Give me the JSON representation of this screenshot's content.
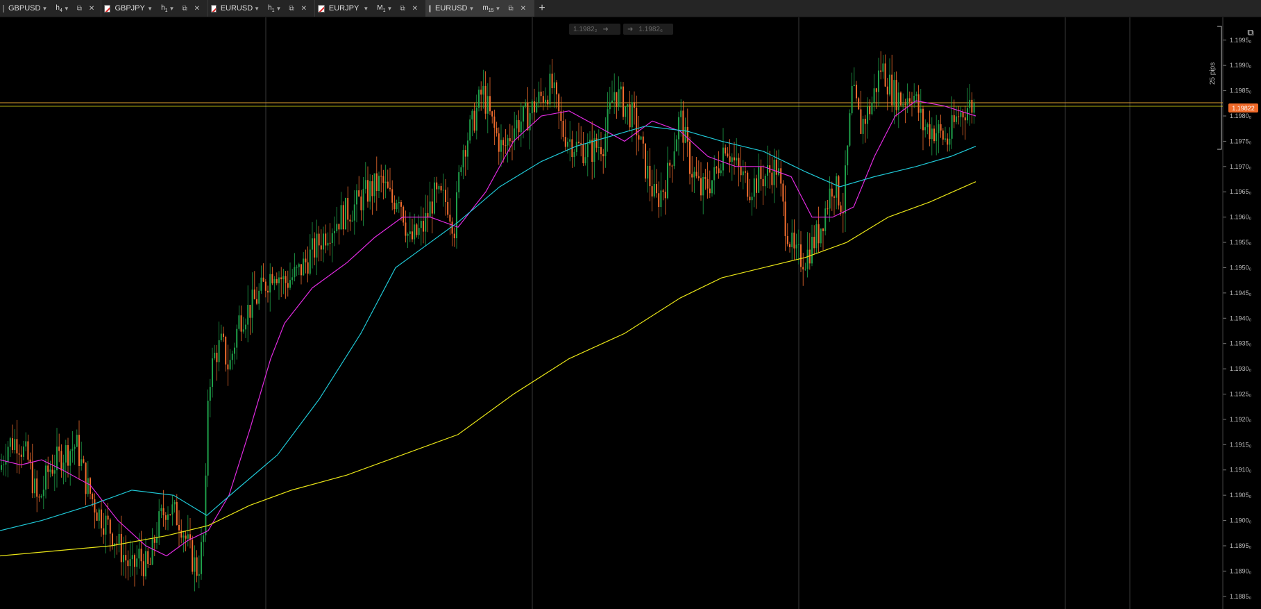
{
  "tabs": [
    {
      "symbol": "GBPUSD",
      "timeframe": "h",
      "tf_sub": "4",
      "active": false
    },
    {
      "symbol": "GBPJPY",
      "timeframe": "h",
      "tf_sub": "1",
      "active": false
    },
    {
      "symbol": "EURUSD",
      "timeframe": "h",
      "tf_sub": "1",
      "active": false
    },
    {
      "symbol": "EURJPY",
      "timeframe": "M",
      "tf_sub": "1",
      "active": false
    },
    {
      "symbol": "EURUSD",
      "timeframe": "m",
      "tf_sub": "15",
      "active": true
    }
  ],
  "add_tab_icon": "plus-icon",
  "trade_panel": {
    "sell_price": "1.1982₂",
    "buy_price": "1.1982₆"
  },
  "current_price": "1.19822",
  "range_label": "25 pips",
  "colors": {
    "bull": "#1fa04a",
    "bear": "#f26d2e",
    "ma_fast": "#e02ae0",
    "ma_mid": "#1fc8d6",
    "ma_slow": "#e8e417",
    "price_line": "#e0a030",
    "background": "#000000"
  },
  "price_axis": {
    "labels": [
      "1.1995₀",
      "1.1990₀",
      "1.1985₀",
      "1.1980₀",
      "1.1975₀",
      "1.1970₀",
      "1.1965₀",
      "1.1960₀",
      "1.1955₀",
      "1.1950₀",
      "1.1945₀",
      "1.1940₀",
      "1.1935₀",
      "1.1930₀",
      "1.1925₀",
      "1.1920₀",
      "1.1915₀",
      "1.1910₀",
      "1.1905₀",
      "1.1900₀",
      "1.1895₀",
      "1.1890₀",
      "1.1885₀"
    ],
    "values": [
      1.1995,
      1.199,
      1.1985,
      1.198,
      1.1975,
      1.197,
      1.1965,
      1.196,
      1.1955,
      1.195,
      1.1945,
      1.194,
      1.1935,
      1.193,
      1.1925,
      1.192,
      1.1915,
      1.191,
      1.1905,
      1.19,
      1.1895,
      1.189,
      1.1885
    ],
    "min": 1.18825,
    "max": 1.19995
  },
  "chart_data": {
    "type": "candlestick",
    "symbol": "EURUSD",
    "timeframe": "m15",
    "price_range": [
      1.18825,
      1.19995
    ],
    "current_price": 1.19822,
    "moving_averages": [
      {
        "color": "#e02ae0",
        "points": [
          [
            0,
            1.1912
          ],
          [
            30,
            1.1911
          ],
          [
            60,
            1.1912
          ],
          [
            90,
            1.191
          ],
          [
            130,
            1.1907
          ],
          [
            170,
            1.19
          ],
          [
            210,
            1.1895
          ],
          [
            240,
            1.1893
          ],
          [
            270,
            1.1896
          ],
          [
            300,
            1.1898
          ],
          [
            330,
            1.1905
          ],
          [
            360,
            1.1918
          ],
          [
            390,
            1.1932
          ],
          [
            410,
            1.1939
          ],
          [
            450,
            1.1946
          ],
          [
            500,
            1.1951
          ],
          [
            540,
            1.1956
          ],
          [
            580,
            1.196
          ],
          [
            620,
            1.196
          ],
          [
            660,
            1.1958
          ],
          [
            700,
            1.1965
          ],
          [
            740,
            1.1975
          ],
          [
            780,
            1.198
          ],
          [
            820,
            1.1981
          ],
          [
            860,
            1.1978
          ],
          [
            900,
            1.1975
          ],
          [
            940,
            1.1979
          ],
          [
            980,
            1.1977
          ],
          [
            1020,
            1.1972
          ],
          [
            1060,
            1.197
          ],
          [
            1100,
            1.197
          ],
          [
            1140,
            1.1968
          ],
          [
            1170,
            1.196
          ],
          [
            1200,
            1.196
          ],
          [
            1230,
            1.1962
          ],
          [
            1260,
            1.1972
          ],
          [
            1290,
            1.198
          ],
          [
            1320,
            1.1983
          ],
          [
            1360,
            1.1982
          ],
          [
            1406,
            1.198
          ]
        ]
      },
      {
        "color": "#1fc8d6",
        "points": [
          [
            0,
            1.1898
          ],
          [
            60,
            1.19
          ],
          [
            130,
            1.1903
          ],
          [
            190,
            1.1906
          ],
          [
            250,
            1.1905
          ],
          [
            298,
            1.1901
          ],
          [
            340,
            1.1906
          ],
          [
            400,
            1.1913
          ],
          [
            460,
            1.1924
          ],
          [
            520,
            1.1937
          ],
          [
            570,
            1.195
          ],
          [
            620,
            1.1955
          ],
          [
            660,
            1.1959
          ],
          [
            720,
            1.1966
          ],
          [
            780,
            1.1971
          ],
          [
            830,
            1.1974
          ],
          [
            880,
            1.1976
          ],
          [
            930,
            1.1978
          ],
          [
            990,
            1.1977
          ],
          [
            1040,
            1.1975
          ],
          [
            1100,
            1.1973
          ],
          [
            1160,
            1.1969
          ],
          [
            1210,
            1.1966
          ],
          [
            1260,
            1.1968
          ],
          [
            1320,
            1.197
          ],
          [
            1370,
            1.1972
          ],
          [
            1406,
            1.1974
          ]
        ]
      },
      {
        "color": "#e8e417",
        "points": [
          [
            0,
            1.1893
          ],
          [
            80,
            1.1894
          ],
          [
            160,
            1.1895
          ],
          [
            240,
            1.1897
          ],
          [
            300,
            1.1899
          ],
          [
            360,
            1.1903
          ],
          [
            420,
            1.1906
          ],
          [
            500,
            1.1909
          ],
          [
            580,
            1.1913
          ],
          [
            660,
            1.1917
          ],
          [
            740,
            1.1925
          ],
          [
            820,
            1.1932
          ],
          [
            900,
            1.1937
          ],
          [
            980,
            1.1944
          ],
          [
            1040,
            1.1948
          ],
          [
            1100,
            1.195
          ],
          [
            1160,
            1.1952
          ],
          [
            1220,
            1.1955
          ],
          [
            1280,
            1.196
          ],
          [
            1340,
            1.1963
          ],
          [
            1406,
            1.1967
          ]
        ]
      }
    ],
    "price_path": [
      [
        0,
        1.191
      ],
      [
        10,
        1.1915
      ],
      [
        25,
        1.1916
      ],
      [
        40,
        1.1912
      ],
      [
        55,
        1.1903
      ],
      [
        70,
        1.191
      ],
      [
        90,
        1.1913
      ],
      [
        110,
        1.1915
      ],
      [
        125,
        1.1907
      ],
      [
        140,
        1.1902
      ],
      [
        160,
        1.1898
      ],
      [
        175,
        1.1894
      ],
      [
        190,
        1.189
      ],
      [
        200,
        1.1893
      ],
      [
        215,
        1.189
      ],
      [
        225,
        1.1898
      ],
      [
        240,
        1.1903
      ],
      [
        260,
        1.19
      ],
      [
        275,
        1.1893
      ],
      [
        285,
        1.189
      ],
      [
        295,
        1.1898
      ],
      [
        300,
        1.1927
      ],
      [
        310,
        1.1933
      ],
      [
        320,
        1.1935
      ],
      [
        330,
        1.193
      ],
      [
        345,
        1.194
      ],
      [
        360,
        1.1942
      ],
      [
        375,
        1.1945
      ],
      [
        395,
        1.195
      ],
      [
        410,
        1.1947
      ],
      [
        430,
        1.1949
      ],
      [
        450,
        1.1953
      ],
      [
        470,
        1.1957
      ],
      [
        490,
        1.196
      ],
      [
        510,
        1.1962
      ],
      [
        530,
        1.1965
      ],
      [
        550,
        1.1967
      ],
      [
        565,
        1.1963
      ],
      [
        575,
        1.1965
      ],
      [
        590,
        1.1955
      ],
      [
        610,
        1.1958
      ],
      [
        625,
        1.1964
      ],
      [
        645,
        1.1963
      ],
      [
        655,
        1.1958
      ],
      [
        665,
        1.1973
      ],
      [
        680,
        1.1978
      ],
      [
        695,
        1.1985
      ],
      [
        710,
        1.1978
      ],
      [
        725,
        1.1973
      ],
      [
        740,
        1.1978
      ],
      [
        760,
        1.198
      ],
      [
        775,
        1.1983
      ],
      [
        795,
        1.1986
      ],
      [
        810,
        1.1977
      ],
      [
        830,
        1.1974
      ],
      [
        850,
        1.1973
      ],
      [
        870,
        1.1975
      ],
      [
        885,
        1.1985
      ],
      [
        900,
        1.1982
      ],
      [
        915,
        1.1979
      ],
      [
        930,
        1.197
      ],
      [
        945,
        1.1963
      ],
      [
        960,
        1.1967
      ],
      [
        980,
        1.198
      ],
      [
        995,
        1.197
      ],
      [
        1010,
        1.1965
      ],
      [
        1030,
        1.1968
      ],
      [
        1045,
        1.1975
      ],
      [
        1060,
        1.197
      ],
      [
        1080,
        1.1966
      ],
      [
        1100,
        1.1968
      ],
      [
        1120,
        1.197
      ],
      [
        1130,
        1.196
      ],
      [
        1145,
        1.1952
      ],
      [
        1160,
        1.1952
      ],
      [
        1180,
        1.1957
      ],
      [
        1200,
        1.1967
      ],
      [
        1215,
        1.1962
      ],
      [
        1228,
        1.1985
      ],
      [
        1240,
        1.1978
      ],
      [
        1255,
        1.1982
      ],
      [
        1270,
        1.199
      ],
      [
        1285,
        1.1985
      ],
      [
        1300,
        1.1983
      ],
      [
        1315,
        1.1985
      ],
      [
        1330,
        1.1978
      ],
      [
        1350,
        1.1977
      ],
      [
        1365,
        1.1975
      ],
      [
        1380,
        1.198
      ],
      [
        1395,
        1.1982
      ],
      [
        1406,
        1.1982
      ]
    ]
  }
}
